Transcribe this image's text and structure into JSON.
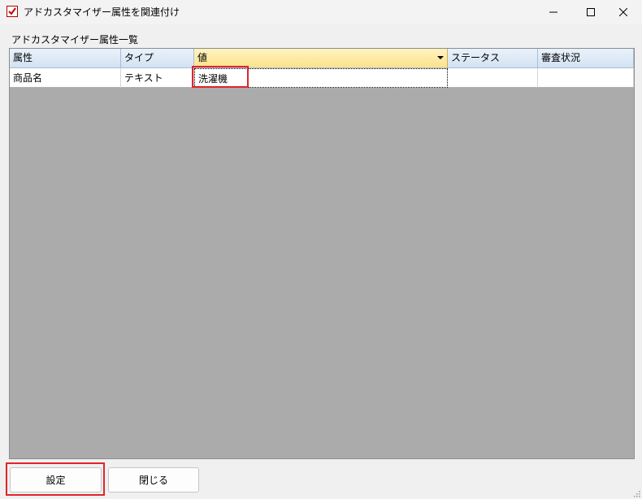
{
  "window": {
    "title": "アドカスタマイザー属性を関連付け",
    "icon": "app-checkmark-icon"
  },
  "section_label": "アドカスタマイザー属性一覧",
  "table": {
    "columns": [
      "属性",
      "タイプ",
      "値",
      "ステータス",
      "審査状況"
    ],
    "rows": [
      [
        "商品名",
        "テキスト",
        "洗濯機",
        "",
        ""
      ]
    ]
  },
  "buttons": {
    "set": "設定",
    "close": "閉じる"
  },
  "colors": {
    "highlight": "#e0242a",
    "selected_header": "#fde28a",
    "grid_background": "#ababab"
  }
}
